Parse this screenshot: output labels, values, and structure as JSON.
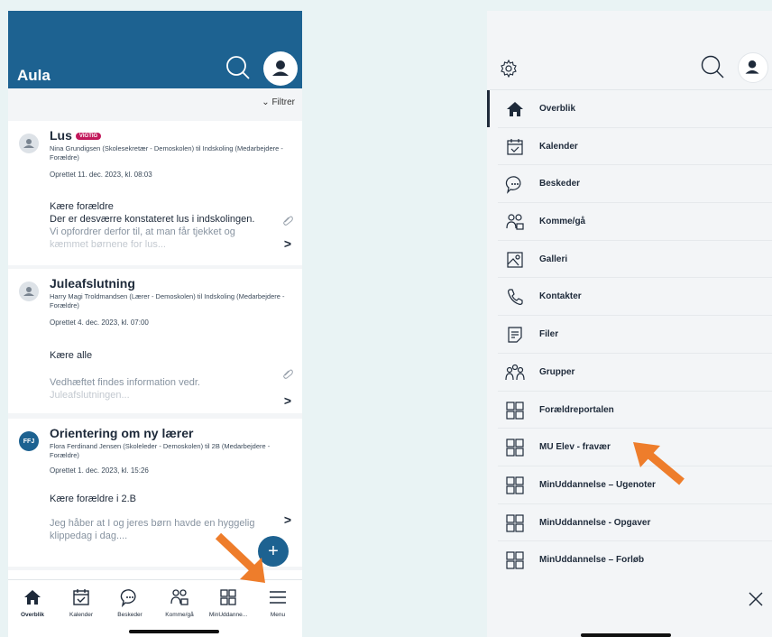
{
  "left": {
    "app_title": "Aula",
    "filter_label": "Filtrer",
    "posts": [
      {
        "title": "Lus",
        "badge": "VIGTIG",
        "meta": "Nina Grundigsen (Skolesekretær - Demoskolen) til Indskoling (Medarbejdere - Forældre)",
        "created": "Oprettet 11. dec. 2023, kl. 08:03",
        "line1": "Kære forældre",
        "line2": "Der er desværre konstateret lus i indskolingen.",
        "line3": "Vi opfordrer derfor til, at man får tjekket og",
        "line4": "kæmmet børnene for lus..."
      },
      {
        "title": "Juleafslutning",
        "meta": "Harry Magi Troldmandsen (Lærer - Demoskolen) til Indskoling (Medarbejdere - Forældre)",
        "created": "Oprettet 4. dec. 2023, kl. 07:00",
        "line1": "Kære alle",
        "line2": "Vedhæftet findes information vedr.",
        "line3": "Juleafslutningen..."
      },
      {
        "avatar_initials": "FFJ",
        "title": "Orientering om ny lærer",
        "meta": "Flora Ferdinand Jensen (Skoleleder - Demoskolen) til 2B (Medarbejdere - Forældre)",
        "created": "Oprettet 1. dec. 2023, kl. 15:26",
        "line1": "Kære forældre i 2.B",
        "line2": "Jeg håber at I og jeres børn havde en hyggelig",
        "line3": "klippedag i dag...."
      }
    ],
    "fab_label": "+",
    "bottom_nav": [
      "Overblik",
      "Kalender",
      "Beskeder",
      "Komme/gå",
      "MinUddanne...",
      "Menu"
    ]
  },
  "right": {
    "menu_items": [
      {
        "label": "Overblik",
        "icon": "home-icon"
      },
      {
        "label": "Kalender",
        "icon": "calendar-icon"
      },
      {
        "label": "Beskeder",
        "icon": "chat-icon"
      },
      {
        "label": "Komme/gå",
        "icon": "people-icon"
      },
      {
        "label": "Galleri",
        "icon": "gallery-icon"
      },
      {
        "label": "Kontakter",
        "icon": "phone-icon"
      },
      {
        "label": "Filer",
        "icon": "file-icon"
      },
      {
        "label": "Grupper",
        "icon": "group-icon"
      },
      {
        "label": "Forældreportalen",
        "icon": "grid-icon"
      },
      {
        "label": "MU Elev - fravær",
        "icon": "grid-icon"
      },
      {
        "label": "MinUddannelse – Ugenoter",
        "icon": "grid-icon"
      },
      {
        "label": "MinUddannelse - Opgaver",
        "icon": "grid-icon"
      },
      {
        "label": "MinUddannelse – Forløb",
        "icon": "grid-icon"
      }
    ]
  },
  "colors": {
    "brand": "#1d6291",
    "badge": "#c2185b",
    "annotation_arrow": "#ee7d2b",
    "background": "#e9f3f4"
  }
}
